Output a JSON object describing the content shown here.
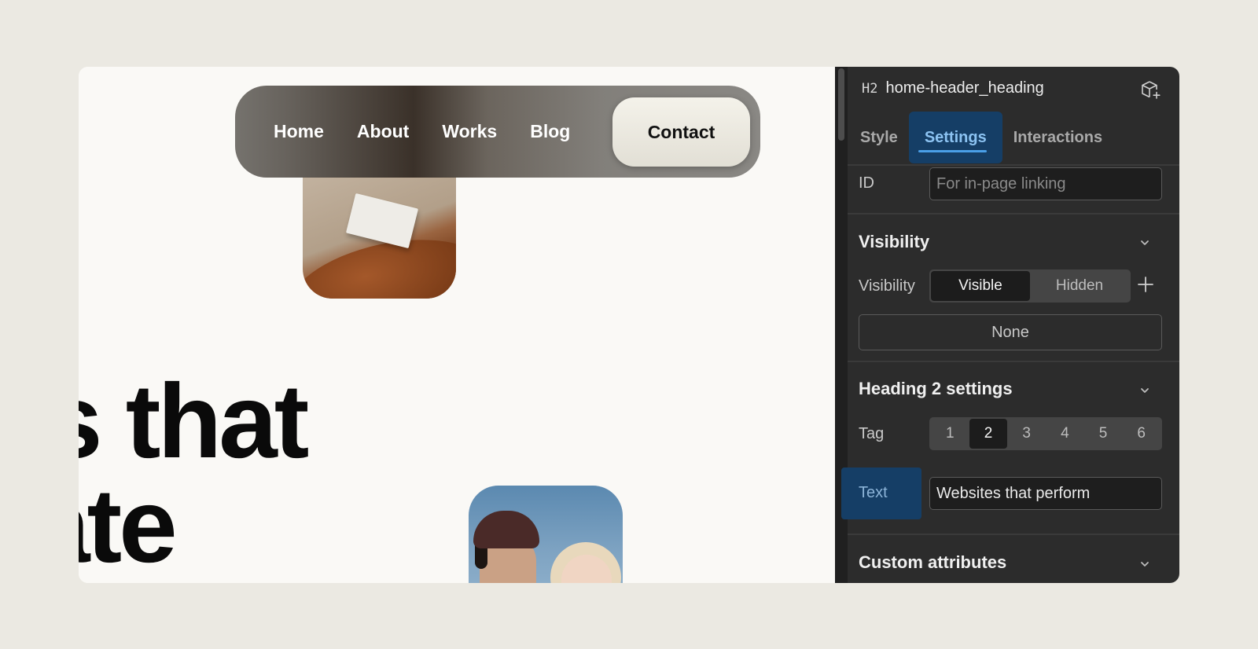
{
  "canvas": {
    "nav": {
      "links": [
        "Home",
        "About",
        "Works",
        "Blog"
      ],
      "contact_label": "Contact"
    },
    "hero": {
      "line1": "s that",
      "line2": "ate"
    }
  },
  "panel": {
    "element": {
      "tag_badge": "H2",
      "name": "home-header_heading"
    },
    "tabs": [
      {
        "label": "Style",
        "active": false
      },
      {
        "label": "Settings",
        "active": true
      },
      {
        "label": "Interactions",
        "active": false
      }
    ],
    "id_field": {
      "label": "ID",
      "value": "",
      "placeholder": "For in-page linking"
    },
    "visibility_section": {
      "title": "Visibility",
      "row_label": "Visibility",
      "options": [
        "Visible",
        "Hidden"
      ],
      "selected": "Visible",
      "condition_label": "None"
    },
    "heading_section": {
      "title": "Heading 2 settings",
      "tag_label": "Tag",
      "tag_options": [
        "1",
        "2",
        "3",
        "4",
        "5",
        "6"
      ],
      "selected_tag": "2",
      "text_label": "Text",
      "text_value": "Websites that perform"
    },
    "custom_attributes_section": {
      "title": "Custom attributes"
    }
  },
  "colors": {
    "page_bg": "#ebe9e2",
    "canvas_bg": "#faf9f6",
    "panel_bg": "#2c2c2c",
    "accent_blue": "#4a9fe8",
    "highlight_bg": "#153e66"
  },
  "icons": [
    "cube-plus-icon",
    "chevron-down-icon",
    "plus-icon"
  ]
}
